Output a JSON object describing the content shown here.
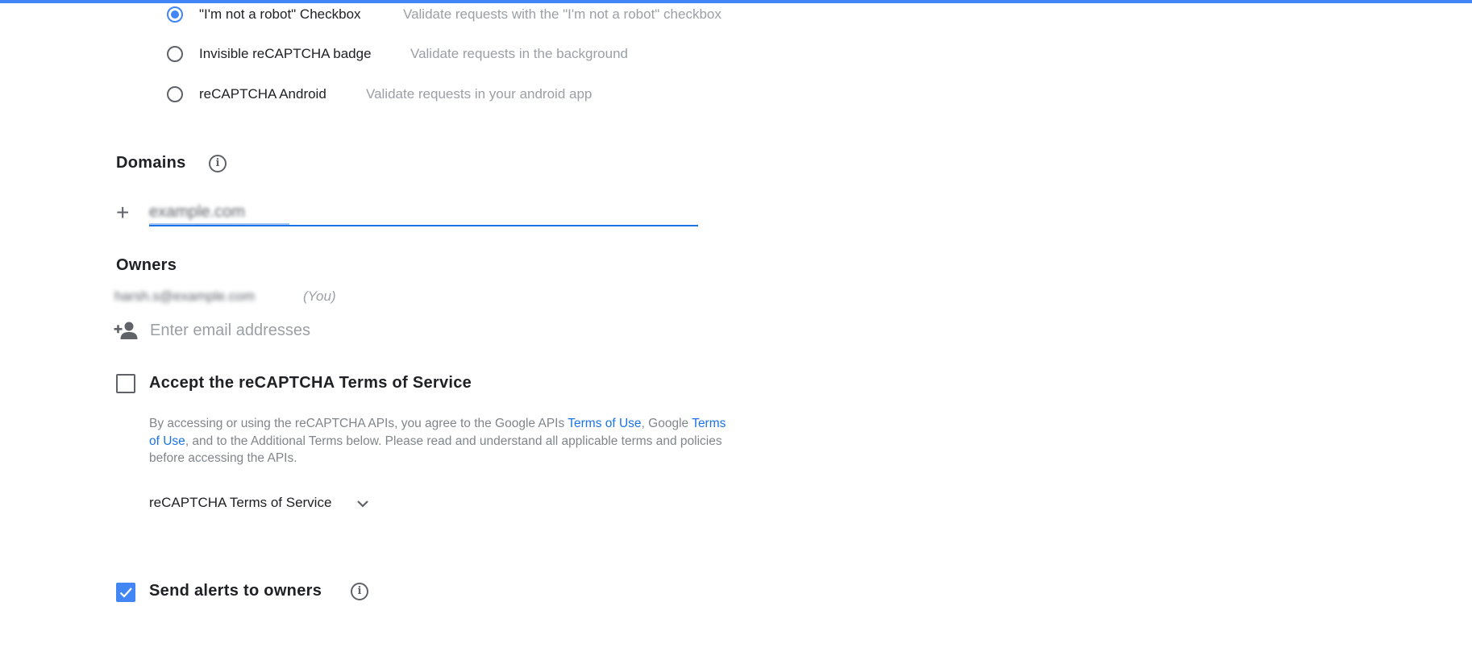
{
  "colors": {
    "accent": "#4285f4",
    "link": "#1a73e8",
    "muted_text": "#9aa0a6",
    "icon_gray": "#5f6368"
  },
  "recaptcha_type": {
    "options": [
      {
        "label": "\"I'm not a robot\" Checkbox",
        "description": "Validate requests with the \"I'm not a robot\" checkbox",
        "selected": true
      },
      {
        "label": "Invisible reCAPTCHA badge",
        "description": "Validate requests in the background",
        "selected": false
      },
      {
        "label": "reCAPTCHA Android",
        "description": "Validate requests in your android app",
        "selected": false
      }
    ]
  },
  "domains": {
    "title": "Domains",
    "info_icon": "info-icon",
    "add_icon": "plus-icon",
    "input_value": "example.com"
  },
  "owners": {
    "title": "Owners",
    "owner_email": "harsh.s@example.com",
    "you_label": "(You)",
    "add_icon": "person-add-icon",
    "email_placeholder": "Enter email addresses"
  },
  "terms": {
    "checkbox_label": "Accept the reCAPTCHA Terms of Service",
    "checked": false,
    "text_part1": "By accessing or using the reCAPTCHA APIs, you agree to the Google APIs ",
    "link1": "Terms of Use",
    "text_part2": ", Google ",
    "link2": "Terms of Use",
    "text_part3": ", and to the Additional Terms below. Please read and understand all applicable terms and policies before accessing the APIs.",
    "dropdown_label": "reCAPTCHA Terms of Service",
    "dropdown_icon": "chevron-down-icon"
  },
  "alerts": {
    "checkbox_label": "Send alerts to owners",
    "checked": true,
    "info_icon": "info-icon"
  }
}
